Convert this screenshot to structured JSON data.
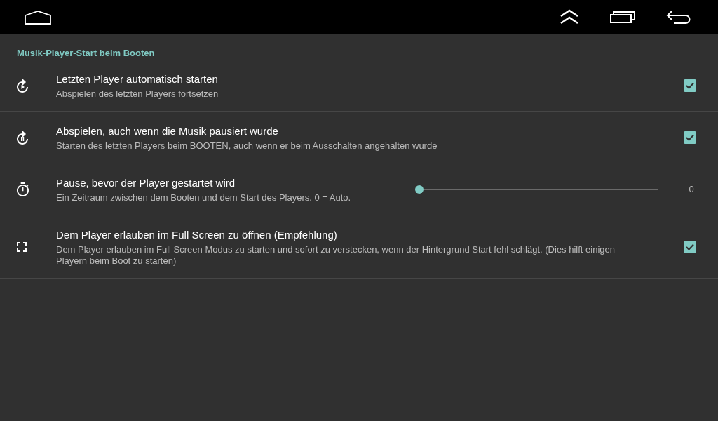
{
  "section": {
    "title": "Musik-Player-Start beim Booten",
    "rows": [
      {
        "kind": "checkbox",
        "title": "Letzten Player automatisch starten",
        "summary": "Abspielen des letzten Players fortsetzen",
        "checked": true
      },
      {
        "kind": "checkbox",
        "title": "Abspielen, auch wenn die Musik pausiert wurde",
        "summary": "Starten des letzten Players beim BOOTEN, auch wenn er beim Ausschalten angehalten wurde",
        "checked": true
      },
      {
        "kind": "slider",
        "title": "Pause, bevor der Player gestartet wird",
        "summary": "Ein Zeitraum zwischen dem Booten und dem Start des Players. 0 = Auto.",
        "level": 0,
        "reading": "0"
      },
      {
        "kind": "checkbox",
        "title": "Dem Player erlauben im Full Screen zu öffnen (Empfehlung)",
        "summary": "Dem Player erlauben im Full Screen Modus zu starten und sofort zu verstecken, wenn der Hintergrund Start fehl schlägt. (Dies hilft einigen Playern beim Boot zu starten)",
        "checked": true
      }
    ]
  }
}
